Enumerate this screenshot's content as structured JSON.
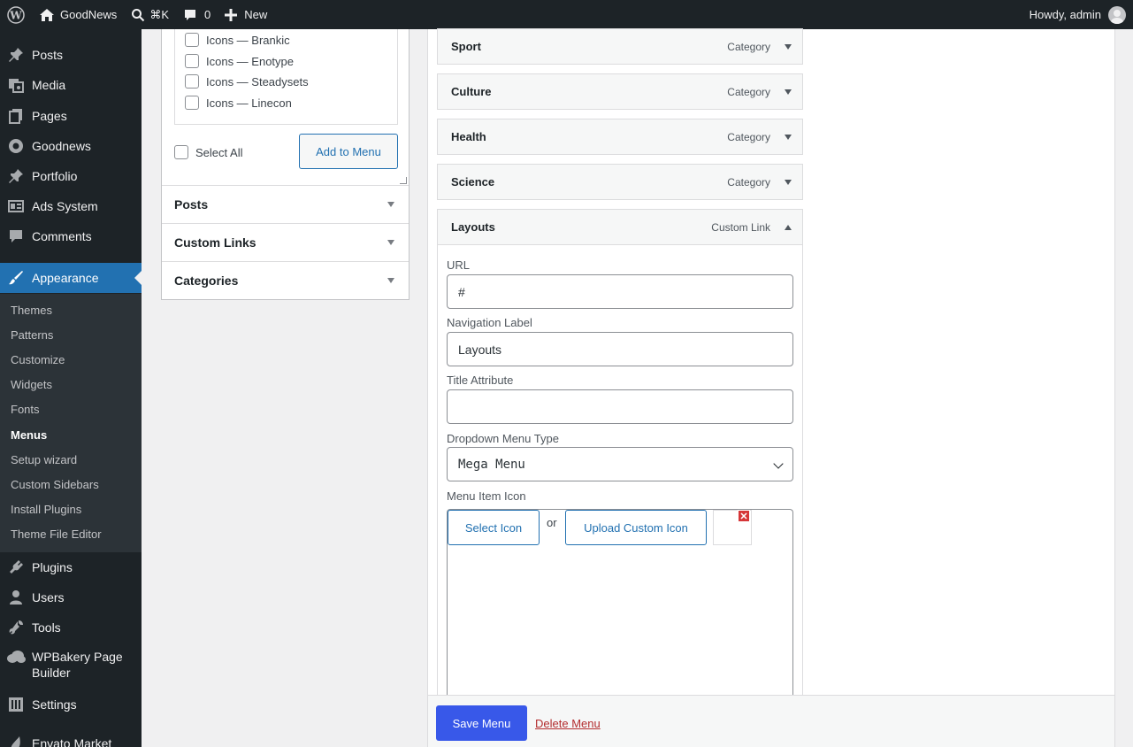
{
  "adminbar": {
    "site_name": "GoodNews",
    "search_shortcut": "⌘K",
    "comments_count": "0",
    "new_label": "New",
    "howdy": "Howdy, admin"
  },
  "sidebar": {
    "items": [
      {
        "label": "Posts",
        "icon": "pin-icon"
      },
      {
        "label": "Media",
        "icon": "media-icon"
      },
      {
        "label": "Pages",
        "icon": "pages-icon"
      },
      {
        "label": "Goodnews",
        "icon": "goodnews-icon"
      },
      {
        "label": "Portfolio",
        "icon": "pin-icon"
      },
      {
        "label": "Ads System",
        "icon": "ads-icon"
      },
      {
        "label": "Comments",
        "icon": "comment-icon"
      },
      {
        "label": "Appearance",
        "icon": "brush-icon"
      },
      {
        "label": "Plugins",
        "icon": "plugin-icon"
      },
      {
        "label": "Users",
        "icon": "user-icon"
      },
      {
        "label": "Tools",
        "icon": "wrench-icon"
      },
      {
        "label": "WPBakery Page Builder",
        "icon": "cloud-icon"
      },
      {
        "label": "Settings",
        "icon": "settings-icon"
      },
      {
        "label": "Envato Market",
        "icon": "envato-icon"
      }
    ],
    "submenu": [
      "Themes",
      "Patterns",
      "Customize",
      "Widgets",
      "Fonts",
      "Menus",
      "Setup wizard",
      "Custom Sidebars",
      "Install Plugins",
      "Theme File Editor"
    ]
  },
  "left_panel": {
    "icon_items": [
      "Icons — Brankic",
      "Icons — Enotype",
      "Icons — Steadysets",
      "Icons — Linecon"
    ],
    "select_all": "Select All",
    "add_to_menu": "Add to Menu",
    "sections": [
      "Posts",
      "Custom Links",
      "Categories"
    ]
  },
  "menu_items": [
    {
      "title": "Sport",
      "type": "Category"
    },
    {
      "title": "Culture",
      "type": "Category"
    },
    {
      "title": "Health",
      "type": "Category"
    },
    {
      "title": "Science",
      "type": "Category"
    },
    {
      "title": "Layouts",
      "type": "Custom Link"
    }
  ],
  "item_settings": {
    "url_label": "URL",
    "url_value": "#",
    "nav_label": "Navigation Label",
    "nav_value": "Layouts",
    "title_attr_label": "Title Attribute",
    "title_attr_value": "",
    "dropdown_label": "Dropdown Menu Type",
    "dropdown_value": "Mega Menu",
    "icon_label": "Menu Item Icon",
    "select_icon": "Select Icon",
    "or": "or",
    "upload_icon": "Upload Custom Icon"
  },
  "footer": {
    "save": "Save Menu",
    "delete": "Delete Menu"
  },
  "colors": {
    "admin_dark": "#1d2327",
    "accent": "#2271b1",
    "save_button": "#3858e9",
    "delete_link": "#b32d2e"
  }
}
